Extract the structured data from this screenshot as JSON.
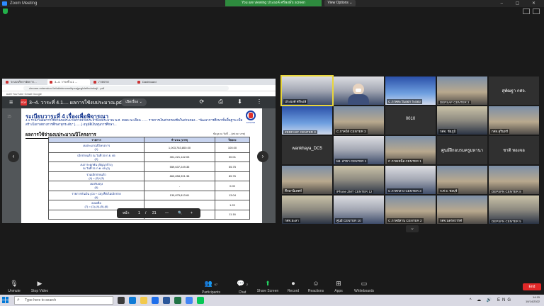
{
  "window": {
    "title": "Zoom Meeting",
    "controls": "–  ▢  ✕"
  },
  "top": {
    "banner_text": "You are viewing ประยงค์ ศรีพงษ์'s screen",
    "view_options": "View Options ⌄"
  },
  "browser": {
    "tabs": [
      "ระบบบริหารจัดการ…",
      "3--4. วาระที่ 4.1 …",
      "ภาพถ่าย",
      "Dashboard"
    ],
    "url": "chrome-extension://efaidnbmnnnibpcajpcglclefindmkaj/...pdf",
    "bookmarks": "แอป   YouTube   Gmail   Google"
  },
  "pdf": {
    "menu_icon": "≡",
    "file_icon": "PDF",
    "title": "3--4. วาระที่ 4.1.... ผลการใช้งบประมาณ.pdf",
    "fit_label": "เปิดเรื่อง ⌄",
    "toolbar_icons": "⟳ ⎙ ⬇ ⋮",
    "page_number_left": "15",
    "prev": "‹",
    "next": "›",
    "agenda_title": "ระเบียบวาระที่ 4  เรื่องเพื่อพิจารณา",
    "agenda_sub": "4.1 รายงานผลการใช้จ่ายงบประมาณรายจ่ายประจำปีงบประมาณ พ.ศ. 2565  ณ เดือน ....... รายการเงินค่าครองชีพในส่วนของ... \"พัฒนาการศึกษาขั้นพื้นฐาน เพื่อสร้างโอกาสทางการศึกษาทุกระดับ\" (.......) อนุมัติเงินทุนการศึกษา...",
    "logo_text": "ECSKSR",
    "results_title": "ผลการใช้จ่ายงบประมาณปีโครงการ",
    "unit_note": "ข้อมูล ณ วันที่ ... (หน่วย: บาท)",
    "table": {
      "headers": [
        "รายการ",
        "จำนวน (บาท)",
        "ร้อยละ"
      ],
      "rows": [
        {
          "label": "งบประมาณปีโครงการ\n(1)",
          "amount": "1,003,763,800.00",
          "pct": "100.00"
        },
        {
          "label": "เบิกจ่ายแล้ว ณ วันที่ 30 ก.ย. 65\n(2)",
          "amount": "301,221,142.03",
          "pct": "30.01"
        },
        {
          "label": "งบภาระผูกพัน (สัญญาจ้าง)\nณ วันที่ 31 ก.ค. 65 (3)",
          "amount": "559,637,249.35",
          "pct": "55.75"
        },
        {
          "label": "รวมเบิกจ่ายแล้ว\n(4) = (2)+(3)",
          "amount": "860,858,391.38",
          "pct": "85.76"
        },
        {
          "label": "งบปรับปรุง\n(5)",
          "amount": "-",
          "pct": "0.00"
        },
        {
          "label": "รายการกันเงิน (C6 + C8) ที่ยังไม่เบิกจ่าย\n(6)",
          "amount": "130,875,813.61",
          "pct": "13.04"
        },
        {
          "label": "คงเหลือ\n(7) = (1)-(4)-(5)-(6)",
          "amount": "",
          "pct": "1.20"
        },
        {
          "label": "",
          "amount": "112,037,151.17",
          "pct": "11.16"
        }
      ]
    },
    "footer": {
      "label": "หน้า",
      "current": "1",
      "sep": "/",
      "total": "21",
      "minus": "—",
      "zoom_icon": "🔍",
      "plus": "+"
    }
  },
  "gallery": {
    "tiles": [
      {
        "name": "ประยงค์ ศรีพงษ์",
        "kind": "active"
      },
      {
        "name": "",
        "kind": "photo2"
      },
      {
        "name": "C ภาคตะวันออก ระยอง",
        "kind": "blue"
      },
      {
        "name": "DEPSAF CENTER 2",
        "kind": "photo"
      },
      {
        "name": "",
        "kind": "text",
        "text": "สุพัฒฐา กศจ."
      },
      {
        "name": "ZEDFASF CENTER 3",
        "kind": "blue"
      },
      {
        "name": "C ภาคใต้ CENTER 3",
        "kind": "photo"
      },
      {
        "name": "",
        "kind": "text",
        "text": "0010"
      },
      {
        "name": "กศจ. ชัยภูมิ",
        "kind": "photo3"
      },
      {
        "name": "กศจ.สุรินทร์",
        "kind": "photo"
      },
      {
        "name": "",
        "kind": "text",
        "text": "wankhaya_DC5"
      },
      {
        "name": "ผอ. สาขา CENTER 1",
        "kind": "photo2"
      },
      {
        "name": "C ภาคเหนือ CENTER 1",
        "kind": "photo"
      },
      {
        "name": "",
        "kind": "text",
        "text": "ศูนย์ฝึกอบรมครูมหานา"
      },
      {
        "name": "",
        "kind": "text",
        "text": "ชาติ ทองจอ"
      },
      {
        "name": "ศึกษานิเทศก์",
        "kind": "photo"
      },
      {
        "name": "iPhone ZMT CENTER 12",
        "kind": "photo3"
      },
      {
        "name": "C ภาคกลาง CENTER 3",
        "kind": "photo2"
      },
      {
        "name": "ก.ศ.จ. ชลบุรี",
        "kind": "photo"
      },
      {
        "name": "DEPSFN CENTER 8",
        "kind": "photo"
      },
      {
        "name": "กศจ.ยะลา",
        "kind": "photo3"
      },
      {
        "name": "ศูนย์ CENTER 10",
        "kind": "photo2"
      },
      {
        "name": "C ภาคอีสาน CENTER 2",
        "kind": "photo"
      },
      {
        "name": "กศจ.นครสวรรค์",
        "kind": "photo"
      },
      {
        "name": "DEPSFN CENTER 5",
        "kind": "photo3"
      }
    ],
    "collapse_icon": "⌄"
  },
  "controls": {
    "unmute": {
      "icon": "🎙",
      "label": "Unmute"
    },
    "stop_video": {
      "icon": "▶",
      "label": "Stop Video"
    },
    "participants": {
      "icon": "👥",
      "label": "Participants",
      "count": "67"
    },
    "chat": {
      "icon": "💬",
      "label": "Chat",
      "count": "2"
    },
    "share": {
      "icon": "⬆",
      "label": "Share Screen"
    },
    "record": {
      "icon": "⏺",
      "label": "Record"
    },
    "reactions": {
      "icon": "☺",
      "label": "Reactions"
    },
    "apps": {
      "icon": "⊞",
      "label": "Apps"
    },
    "whiteboards": {
      "icon": "▭",
      "label": "Whiteboards"
    },
    "end": "End"
  },
  "taskbar": {
    "search_placeholder": "Type here to search",
    "tray_icons": "^ ☁ 🔊 ENG",
    "time": "14:15",
    "date": "10/14/2022"
  },
  "colors": {
    "accent": "#2d8cff",
    "green": "#2e8b3e",
    "end_red": "#e02828",
    "active_border": "#e9d63b"
  }
}
